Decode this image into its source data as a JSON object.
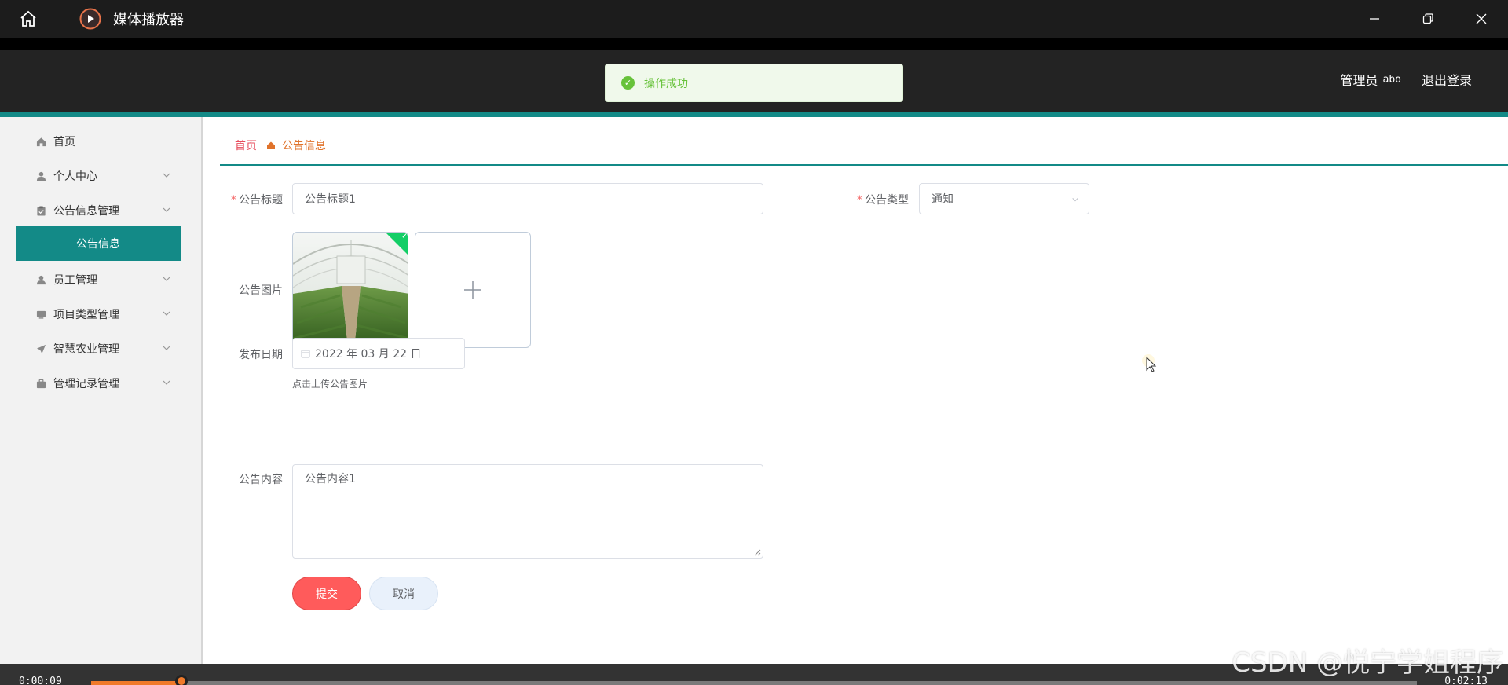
{
  "player": {
    "title": "媒体播放器",
    "time_elapsed": "0:00:09",
    "time_total": "0:02:13",
    "progress": 0.068
  },
  "toast": {
    "message": "操作成功"
  },
  "header": {
    "role": "管理员",
    "username": "abo",
    "logout": "退出登录"
  },
  "sidebar": {
    "items": [
      {
        "label": "首页",
        "icon": "home-icon"
      },
      {
        "label": "个人中心",
        "icon": "user-icon"
      },
      {
        "label": "公告信息管理",
        "icon": "clipboard-icon"
      },
      {
        "label": "员工管理",
        "icon": "user-icon"
      },
      {
        "label": "项目类型管理",
        "icon": "monitor-icon"
      },
      {
        "label": "智慧农业管理",
        "icon": "send-icon"
      },
      {
        "label": "管理记录管理",
        "icon": "briefcase-icon"
      }
    ],
    "active_sub": "公告信息"
  },
  "breadcrumb": {
    "home": "首页",
    "current": "公告信息"
  },
  "form": {
    "title_label": "公告标题",
    "title_value": "公告标题1",
    "type_label": "公告类型",
    "type_value": "通知",
    "image_label": "公告图片",
    "image_tip": "点击上传公告图片",
    "date_label": "发布日期",
    "date_value": "2022 年 03 月 22 日",
    "content_label": "公告内容",
    "content_value": "公告内容1",
    "submit": "提交",
    "cancel": "取消"
  },
  "watermark": "CSDN @悦宁学姐程序",
  "colors": {
    "accent": "#138a87",
    "danger": "#ff5b5b",
    "success": "#67c23a"
  }
}
